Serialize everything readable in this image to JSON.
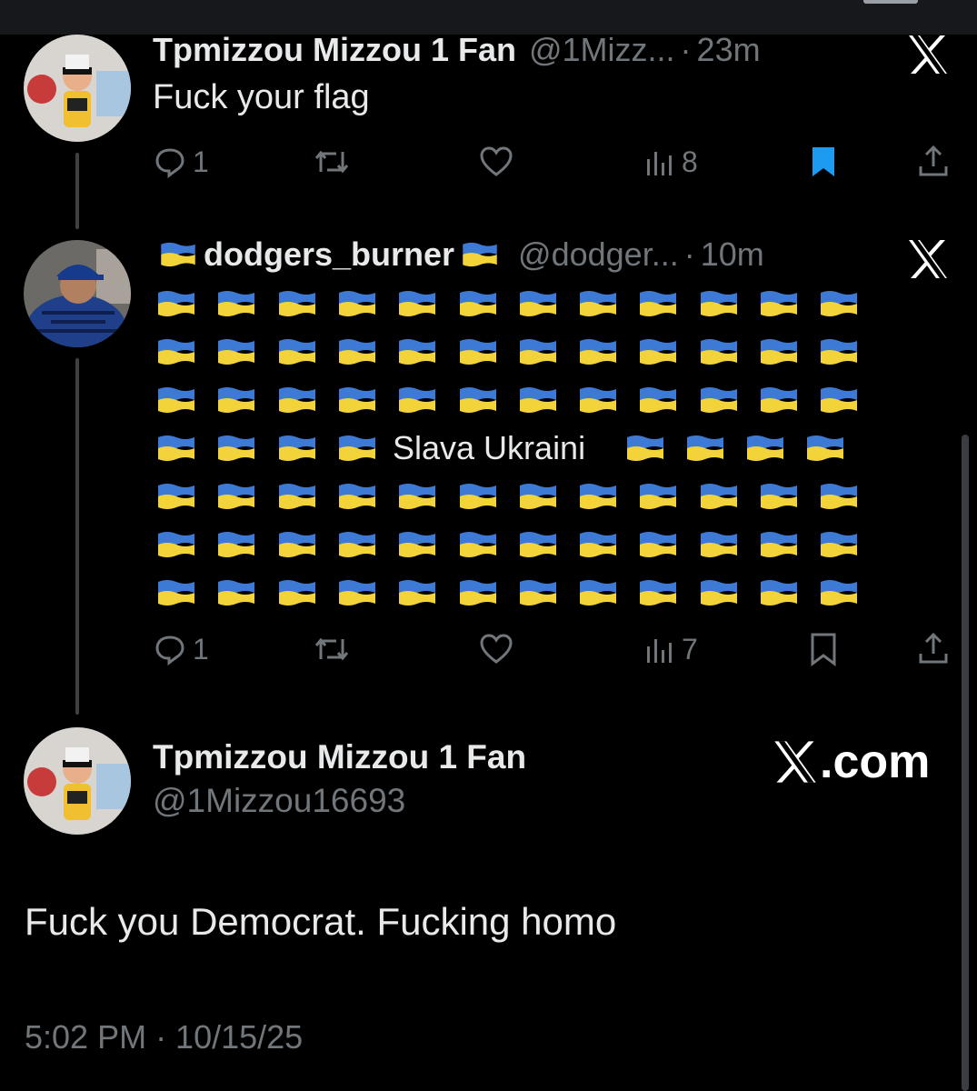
{
  "colors": {
    "background": "#000000",
    "text": "#e7e9ea",
    "muted": "#71767b",
    "bookmark_active": "#1d9bf0",
    "flag_blue": "#3d7ad6",
    "flag_yellow": "#f2d33a"
  },
  "tweets": [
    {
      "name": "Tpmizzou Mizzou 1 Fan",
      "handle": "@1Mizz...",
      "dot": "·",
      "time": "23m",
      "text": "Fuck your flag",
      "replies": "1",
      "views": "8",
      "bookmarked": true
    },
    {
      "name": "dodgers_burner",
      "handle": "@dodger...",
      "dot": "·",
      "time": "10m",
      "phrase": "Slava Ukraini",
      "flag_rows": [
        12,
        12,
        12,
        8,
        12,
        12,
        12
      ],
      "replies": "1",
      "views": "7",
      "bookmarked": false
    }
  ],
  "focus_tweet": {
    "name": "Tpmizzou Mizzou 1 Fan",
    "handle": "@1Mizzou16693",
    "text": "Fuck you Democrat.  Fucking homo",
    "timestamp": "5:02 PM · 10/15/25",
    "brand": ".com"
  },
  "icons": [
    "reply-icon",
    "retweet-icon",
    "like-icon",
    "views-icon",
    "bookmark-icon",
    "share-icon",
    "x-logo-icon",
    "ukraine-flag-icon"
  ]
}
